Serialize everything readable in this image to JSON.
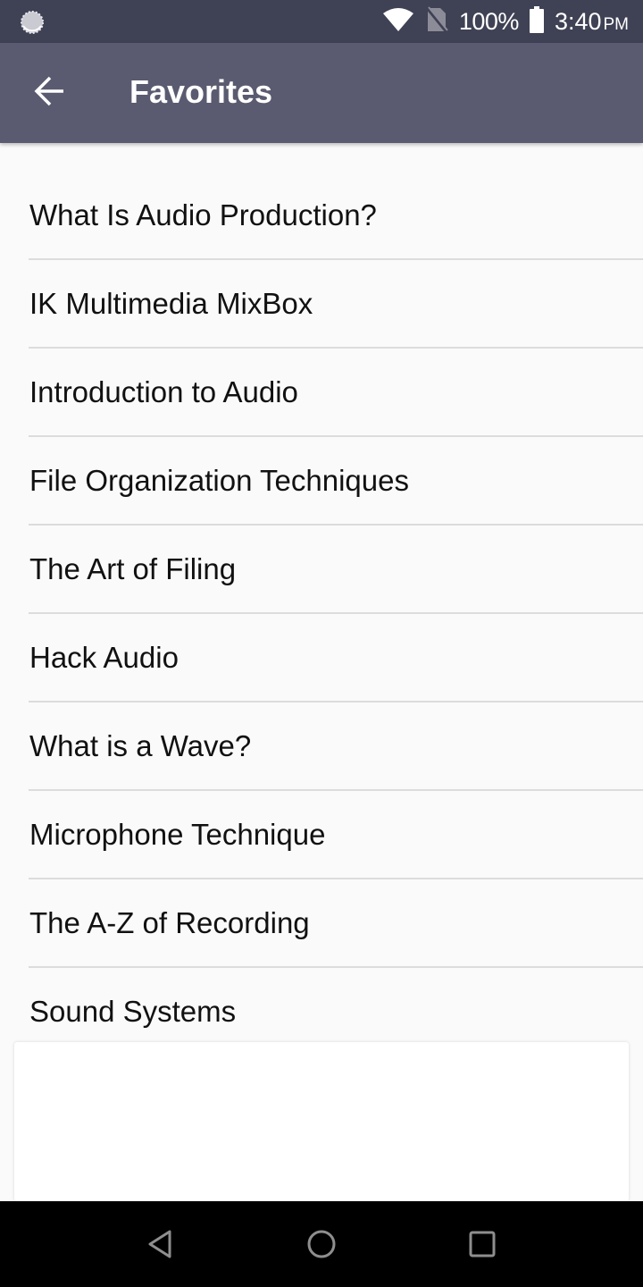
{
  "status_bar": {
    "battery_percent": "100%",
    "time": "3:40",
    "ampm": "PM",
    "icons": [
      "sync-icon",
      "wifi-icon",
      "no-sim-icon",
      "battery-icon"
    ]
  },
  "app_bar": {
    "title": "Favorites",
    "back_icon": "arrow-left-icon"
  },
  "favorites": {
    "items": [
      {
        "label": "What Is Audio Production?"
      },
      {
        "label": "IK Multimedia MixBox"
      },
      {
        "label": "Introduction to Audio"
      },
      {
        "label": "File Organization Techniques"
      },
      {
        "label": "The Art of Filing"
      },
      {
        "label": "Hack Audio"
      },
      {
        "label": "What is a Wave?"
      },
      {
        "label": "Microphone Technique"
      },
      {
        "label": "The A-Z of Recording"
      },
      {
        "label": "Sound Systems"
      }
    ]
  },
  "nav_bar": {
    "buttons": [
      "back-triangle-icon",
      "home-circle-icon",
      "recents-square-icon"
    ]
  },
  "colors": {
    "status_bar_bg": "#3f4154",
    "app_bar_bg": "#5a5b70",
    "list_bg": "#fafafa",
    "divider": "#dcdcdc",
    "text": "#111111"
  }
}
